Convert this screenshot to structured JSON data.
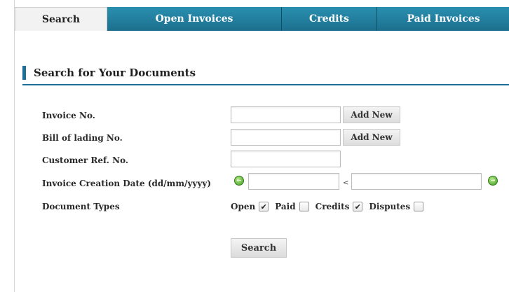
{
  "tabs": [
    {
      "label": "Search",
      "active": true
    },
    {
      "label": "Open Invoices",
      "active": false
    },
    {
      "label": "Credits",
      "active": false
    },
    {
      "label": "Paid Invoices",
      "active": false
    }
  ],
  "section": {
    "title": "Search for Your Documents"
  },
  "form": {
    "invoice_no": {
      "label": "Invoice No.",
      "value": "",
      "add_label": "Add New"
    },
    "bill_of_lading": {
      "label": "Bill of lading No.",
      "value": "",
      "add_label": "Add New"
    },
    "customer_ref": {
      "label": "Customer Ref. No.",
      "value": ""
    },
    "creation_date": {
      "label": "Invoice Creation Date (dd/mm/yyyy)",
      "from_value": "",
      "to_value": "",
      "separator": "<"
    },
    "document_types": {
      "label": "Document Types",
      "options": [
        {
          "label": "Open",
          "checked": true
        },
        {
          "label": "Paid",
          "checked": false
        },
        {
          "label": "Credits",
          "checked": true
        },
        {
          "label": "Disputes",
          "checked": false
        }
      ]
    },
    "search_label": "Search"
  },
  "colors": {
    "tab_blue": "#1c6f8d",
    "accent": "#1d6f9a",
    "calendar_green": "#3c9a1f"
  },
  "icons": {
    "date_from": "calendar-icon",
    "date_to": "calendar-icon",
    "checkmark": "checkmark-icon"
  }
}
